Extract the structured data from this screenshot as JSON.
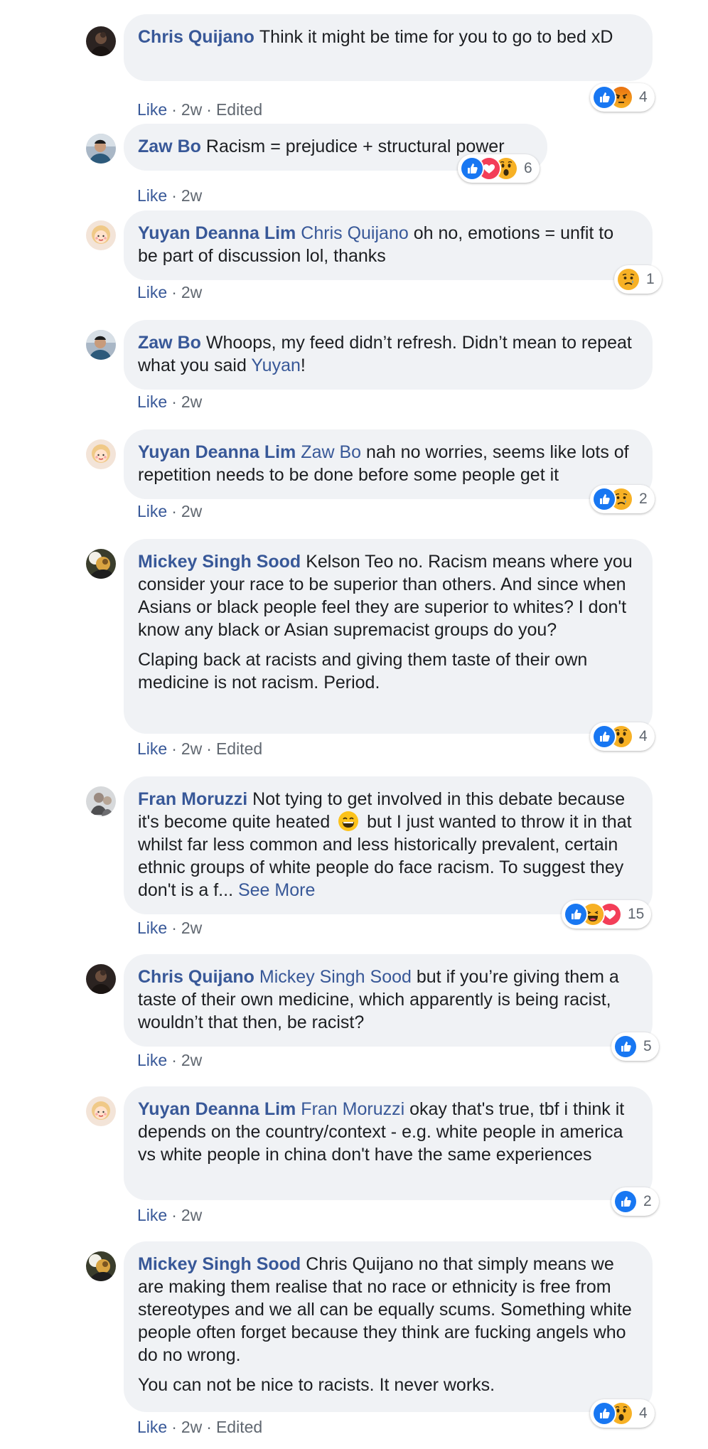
{
  "comments": [
    {
      "author": "Chris Quijano",
      "avatar_icon": "avatar-chris-quijano-icon",
      "paragraphs": [
        [
          {
            "t": "text",
            "v": "Think it might be time for you to go to bed xD"
          }
        ]
      ],
      "meta": {
        "like": "Like",
        "time": "2w",
        "edited": "Edited"
      },
      "reactions": {
        "icons": [
          "like",
          "angry"
        ],
        "count": "4"
      }
    },
    {
      "author": "Zaw Bo",
      "avatar_icon": "avatar-zaw-bo-icon",
      "paragraphs": [
        [
          {
            "t": "text",
            "v": "Racism = prejudice + structural power"
          }
        ]
      ],
      "meta": {
        "like": "Like",
        "time": "2w",
        "edited": ""
      },
      "reactions": {
        "icons": [
          "like",
          "love",
          "wow"
        ],
        "count": "6"
      }
    },
    {
      "author": "Yuyan Deanna Lim",
      "avatar_icon": "avatar-yuyan-deanna-lim-icon",
      "paragraphs": [
        [
          {
            "t": "mention",
            "v": "Chris Quijano"
          },
          {
            "t": "text",
            "v": " oh no, emotions = unfit to be part of discussion lol, thanks"
          }
        ]
      ],
      "meta": {
        "like": "Like",
        "time": "2w",
        "edited": ""
      },
      "reactions": {
        "icons": [
          "sad"
        ],
        "count": "1"
      }
    },
    {
      "author": "Zaw Bo",
      "avatar_icon": "avatar-zaw-bo-icon",
      "paragraphs": [
        [
          {
            "t": "text",
            "v": "Whoops, my feed didn’t refresh. Didn’t mean to repeat what you said "
          },
          {
            "t": "mention",
            "v": "Yuyan"
          },
          {
            "t": "text",
            "v": "!"
          }
        ]
      ],
      "meta": {
        "like": "Like",
        "time": "2w",
        "edited": ""
      },
      "reactions": null
    },
    {
      "author": "Yuyan Deanna Lim",
      "avatar_icon": "avatar-yuyan-deanna-lim-icon",
      "paragraphs": [
        [
          {
            "t": "mention",
            "v": "Zaw Bo"
          },
          {
            "t": "text",
            "v": " nah no worries, seems like lots of repetition needs to be done before some people get it"
          }
        ]
      ],
      "meta": {
        "like": "Like",
        "time": "2w",
        "edited": ""
      },
      "reactions": {
        "icons": [
          "like",
          "sad"
        ],
        "count": "2"
      }
    },
    {
      "author": "Mickey Singh Sood",
      "avatar_icon": "avatar-mickey-singh-sood-icon",
      "paragraphs": [
        [
          {
            "t": "text",
            "v": "Kelson Teo no. Racism means where you consider your race to be superior than others. And since when Asians or black people feel they are superior to whites? I don't know any black or Asian supremacist groups do you?"
          }
        ],
        [
          {
            "t": "text",
            "v": "Claping back at racists and giving them taste of their own medicine is not racism. Period."
          }
        ]
      ],
      "meta": {
        "like": "Like",
        "time": "2w",
        "edited": "Edited"
      },
      "reactions": {
        "icons": [
          "like",
          "wow"
        ],
        "count": "4"
      }
    },
    {
      "author": "Fran Moruzzi",
      "avatar_icon": "avatar-fran-moruzzi-icon",
      "paragraphs": [
        [
          {
            "t": "text",
            "v": "Not tying to get involved in this debate because it's become quite heated "
          },
          {
            "t": "emoji",
            "v": "grin-emoji"
          },
          {
            "t": "text",
            "v": " but I just wanted to throw it in that whilst far less common and less historically prevalent, certain ethnic groups of white people do face racism. To suggest they don't is a f... "
          },
          {
            "t": "seemore",
            "v": "See More"
          }
        ]
      ],
      "meta": {
        "like": "Like",
        "time": "2w",
        "edited": ""
      },
      "reactions": {
        "icons": [
          "like",
          "haha",
          "love"
        ],
        "count": "15"
      }
    },
    {
      "author": "Chris Quijano",
      "avatar_icon": "avatar-chris-quijano-icon",
      "paragraphs": [
        [
          {
            "t": "mention",
            "v": "Mickey Singh Sood"
          },
          {
            "t": "text",
            "v": " but if you’re giving them a taste of their own medicine, which apparently is being racist, wouldn’t that then, be racist?"
          }
        ]
      ],
      "meta": {
        "like": "Like",
        "time": "2w",
        "edited": ""
      },
      "reactions": {
        "icons": [
          "like"
        ],
        "count": "5"
      }
    },
    {
      "author": "Yuyan Deanna Lim",
      "avatar_icon": "avatar-yuyan-deanna-lim-icon",
      "paragraphs": [
        [
          {
            "t": "mention",
            "v": "Fran Moruzzi"
          },
          {
            "t": "text",
            "v": " okay that's true, tbf i think it depends on the country/context - e.g. white people in america vs white people in china don't have the same experiences"
          }
        ]
      ],
      "meta": {
        "like": "Like",
        "time": "2w",
        "edited": ""
      },
      "reactions": {
        "icons": [
          "like"
        ],
        "count": "2"
      }
    },
    {
      "author": "Mickey Singh Sood",
      "avatar_icon": "avatar-mickey-singh-sood-icon",
      "paragraphs": [
        [
          {
            "t": "text",
            "v": "Chris Quijano no that simply means we are making them realise that no race or ethnicity is free from stereotypes and we all can be equally scums. Something white people often forget because they think are fucking angels who do no wrong."
          }
        ],
        [
          {
            "t": "text",
            "v": "You can not be nice to racists. It never works."
          }
        ]
      ],
      "meta": {
        "like": "Like",
        "time": "2w",
        "edited": "Edited"
      },
      "reactions": {
        "icons": [
          "like",
          "wow"
        ],
        "count": "4"
      }
    }
  ],
  "colors": {
    "link": "#385898",
    "bubble": "#f0f2f5",
    "meta": "#606770",
    "like_blue": "#1877f2",
    "love_red": "#f33e58",
    "reaction_yellow": "#f7b125",
    "angry_orange": "#e9710f"
  }
}
